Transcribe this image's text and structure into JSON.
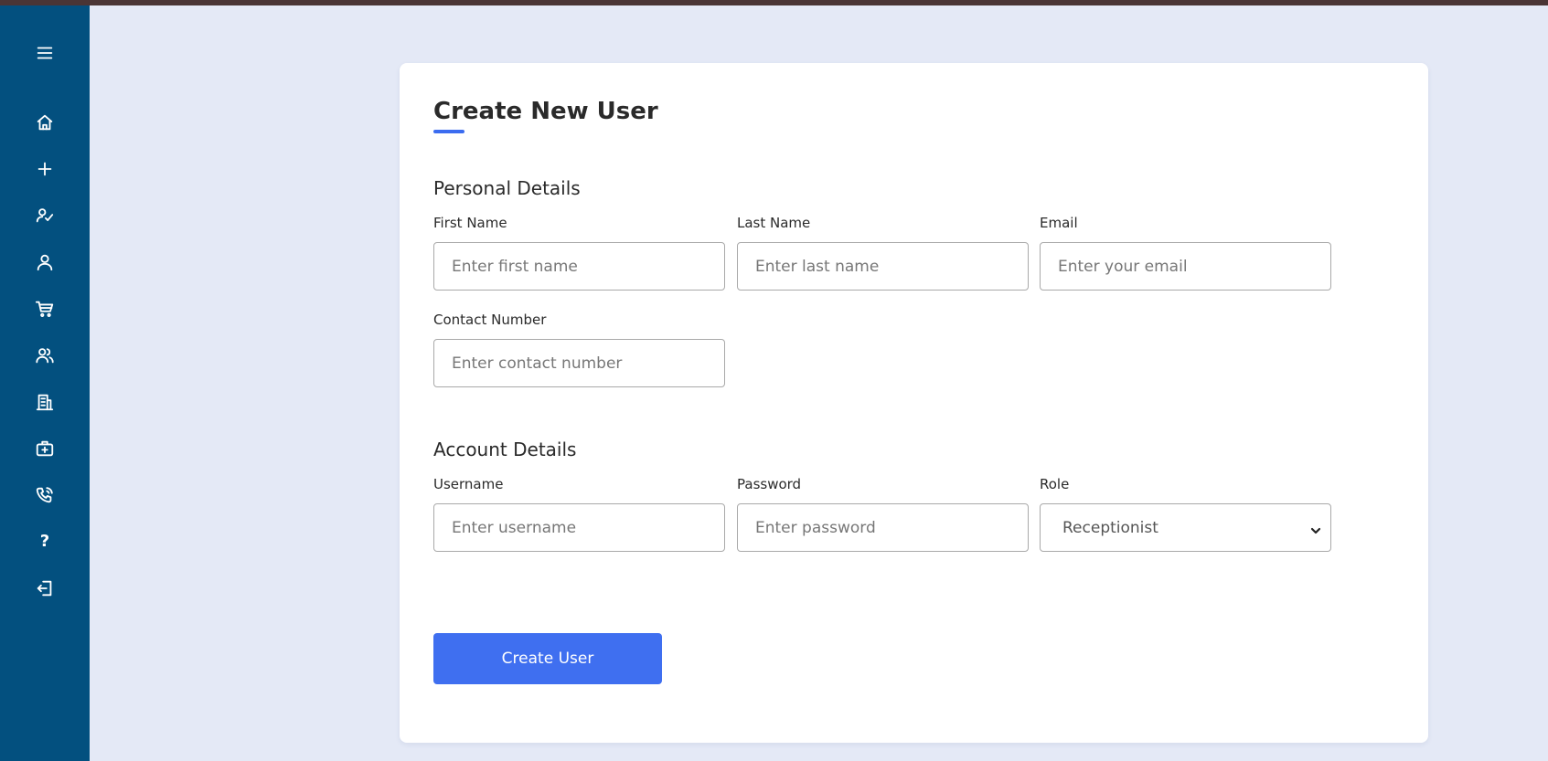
{
  "colors": {
    "sidebar": "#03507f",
    "background": "#e4e9f6",
    "accent": "#3f6ff0",
    "topbar": "#4a3535"
  },
  "sidebar": {
    "items": [
      {
        "icon": "menu-icon"
      },
      {
        "icon": "home-icon"
      },
      {
        "icon": "plus-icon"
      },
      {
        "icon": "user-check-icon"
      },
      {
        "icon": "user-icon"
      },
      {
        "icon": "cart-icon"
      },
      {
        "icon": "users-icon"
      },
      {
        "icon": "building-icon"
      },
      {
        "icon": "medical-kit-icon"
      },
      {
        "icon": "phone-call-icon"
      },
      {
        "icon": "help-icon",
        "glyph": "?"
      },
      {
        "icon": "logout-icon"
      }
    ]
  },
  "form": {
    "title": "Create New User",
    "personal": {
      "heading": "Personal Details",
      "first_name": {
        "label": "First Name",
        "placeholder": "Enter first name",
        "value": ""
      },
      "last_name": {
        "label": "Last Name",
        "placeholder": "Enter last name",
        "value": ""
      },
      "email": {
        "label": "Email",
        "placeholder": "Enter your email",
        "value": ""
      },
      "contact": {
        "label": "Contact Number",
        "placeholder": "Enter contact number",
        "value": ""
      }
    },
    "account": {
      "heading": "Account Details",
      "username": {
        "label": "Username",
        "placeholder": "Enter username",
        "value": ""
      },
      "password": {
        "label": "Password",
        "placeholder": "Enter password",
        "value": ""
      },
      "role": {
        "label": "Role",
        "selected": "Receptionist"
      }
    },
    "submit_label": "Create User"
  }
}
